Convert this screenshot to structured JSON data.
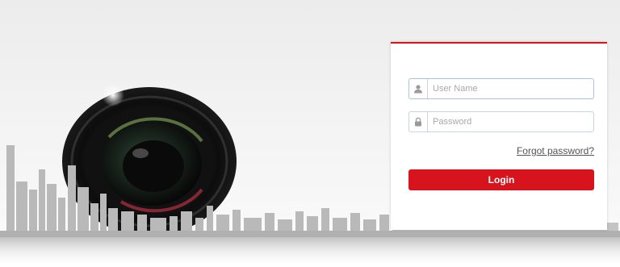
{
  "login": {
    "username_placeholder": "User Name",
    "password_placeholder": "Password",
    "forgot_password": "Forgot password?",
    "login_button": "Login"
  },
  "icons": {
    "username": "user-icon",
    "password": "lock-icon"
  },
  "colors": {
    "accent": "#d7141e",
    "input_border": "#c9d3df",
    "background": "#efefef"
  }
}
